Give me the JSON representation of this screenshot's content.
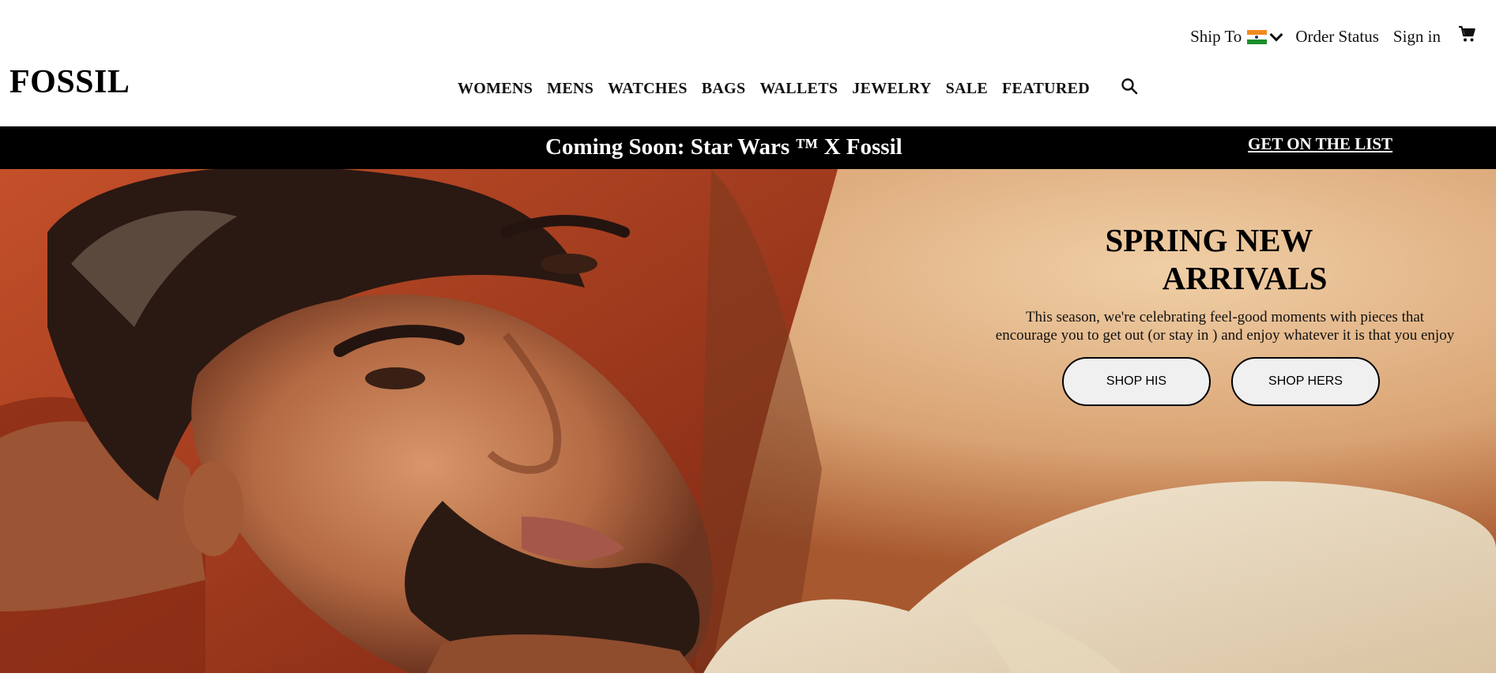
{
  "header": {
    "utility": {
      "ship_to": "Ship To",
      "order_status": "Order Status",
      "sign_in": "Sign in"
    },
    "logo": "FOSSIL",
    "nav": [
      "WOMENS",
      "MENS",
      "WATCHES",
      "BAGS",
      "WALLETS",
      "JEWELRY",
      "SALE",
      "FEATURED"
    ],
    "icons": [
      "india-flag-icon",
      "chevron-down-icon",
      "cart-icon",
      "search-icon"
    ]
  },
  "promo": {
    "text": "Coming Soon: Star Wars ™ X Fossil",
    "link": "GET ON THE LIST"
  },
  "hero": {
    "title_line1": "SPRING NEW",
    "title_line2": "ARRIVALS",
    "subtitle_line1": "This season, we're celebrating feel-good moments with pieces that",
    "subtitle_line2": "encourage you to get out (or stay in ) and enjoy whatever it is that you enjoy",
    "buttons": {
      "his": "SHOP HIS",
      "hers": "SHOP HERS"
    }
  },
  "colors": {
    "promo_bg": "#000000",
    "button_bg": "#f0f0f0",
    "text": "#111111"
  }
}
